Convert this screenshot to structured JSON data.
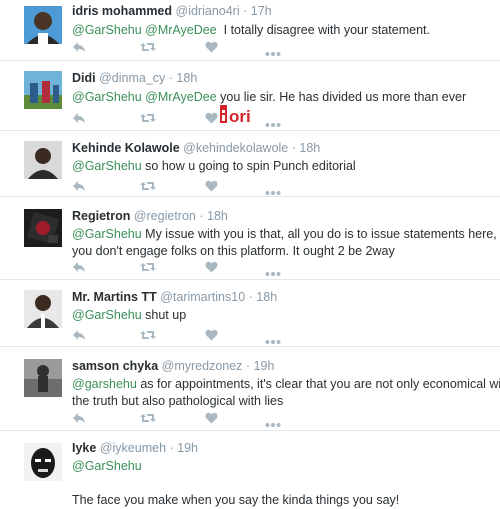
{
  "tweets": [
    {
      "name": "idris mohammed",
      "handle": "@idriano4ri",
      "sep": "·",
      "time": "17h",
      "mentions": [
        "@GarShehu",
        "@MrAyeDee"
      ],
      "text": "I totally disagree with your statement.",
      "avatar_colors": [
        "#4c9bd6",
        "#2a2a2a"
      ]
    },
    {
      "name": "Didi",
      "handle": "@dinma_cy",
      "sep": "·",
      "time": "18h",
      "mentions": [
        "@GarShehu",
        "@MrAyeDee"
      ],
      "text": "you lie sir. He has divided us more than ever",
      "avatar_colors": [
        "#6fb3d9",
        "#2b5c8a"
      ],
      "logo": {
        "text": "iori",
        "color": "#d4232a"
      }
    },
    {
      "name": "Kehinde Kolawole",
      "handle": "@kehindekolawole",
      "sep": "·",
      "time": "18h",
      "mentions": [
        "@GarShehu"
      ],
      "text": "so how u going to spin Punch editorial",
      "avatar_colors": [
        "#d9d9d9",
        "#2c2c2c"
      ]
    },
    {
      "name": "Regietron",
      "handle": "@regietron",
      "sep": "·",
      "time": "18h",
      "mentions": [
        "@GarShehu"
      ],
      "text": "My issue with you is that, all you do is to issue statements here,",
      "text2": "you don't engage folks on this platform. It ought 2 be 2way",
      "avatar_colors": [
        "#1d1d1d",
        "#a11b2b"
      ]
    },
    {
      "name": "Mr. Martins TT",
      "handle": "@tarimartins10",
      "sep": "·",
      "time": "18h",
      "mentions": [
        "@GarShehu"
      ],
      "text": "shut up",
      "avatar_colors": [
        "#e8e8e8",
        "#3a3a3a"
      ]
    },
    {
      "name": "samson chyka",
      "handle": "@myredzonez",
      "sep": "·",
      "time": "19h",
      "mentions": [
        "@garshehu"
      ],
      "text": "as for appointments,  it's clear that you are not only economical with",
      "text2": "the truth but also pathological  with lies",
      "avatar_colors": [
        "#9a9a9a",
        "#303030"
      ]
    },
    {
      "name": "Iyke",
      "handle": "@iykeumeh",
      "sep": "·",
      "time": "19h",
      "mentions": [
        "@GarShehu"
      ],
      "text": "",
      "text2": "The face you make when you say the kinda things you say!",
      "avatar_colors": [
        "#f2f2f2",
        "#1a1a1a"
      ]
    }
  ],
  "icons": {
    "reply": "reply-icon",
    "retweet": "retweet-icon",
    "like": "heart-icon",
    "more": "more-icon"
  },
  "colors": {
    "mention": "#3b8f5a",
    "meta": "#8899a6",
    "icon": "#aab8c2",
    "border": "#e1e8ed"
  }
}
